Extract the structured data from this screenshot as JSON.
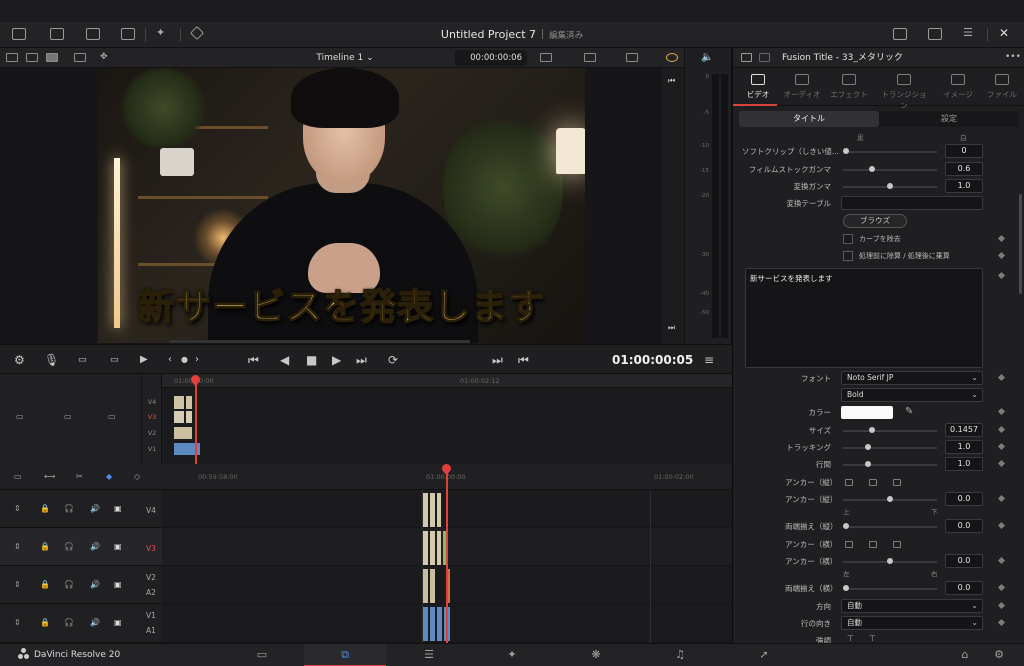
{
  "project": {
    "title": "Untitled Project 7",
    "status": "編集済み"
  },
  "viewer": {
    "timeline_name": "Timeline 1",
    "source_timecode": "00:00:00:06",
    "caption": "新サービスを発表します",
    "playback_timecode": "01:00:00:05"
  },
  "meter": {
    "scale": [
      "0",
      "-5",
      "-10",
      "-15",
      "-20",
      "-30",
      "-40",
      "-50"
    ]
  },
  "timeline": {
    "upper_ruler": [
      "01:00:00:00",
      "01:00:02:12"
    ],
    "upper_tracks": [
      "V4",
      "V3",
      "V2",
      "V1"
    ],
    "lower_ruler": [
      "00:59:58:00",
      "01:00:00:00",
      "01:00:02:00"
    ],
    "tracks": [
      {
        "name": "V4"
      },
      {
        "name": "V3"
      },
      {
        "name": "V2",
        "sub": "A2"
      },
      {
        "name": "V1",
        "sub": "A1"
      }
    ]
  },
  "inspector": {
    "title": "Fusion Title - 33_メタリック",
    "tabs": [
      "ビデオ",
      "オーディオ",
      "エフェクト",
      "トランジション",
      "イメージ",
      "ファイル"
    ],
    "segments": [
      "タイトル",
      "設定"
    ],
    "top_labels": {
      "black": "黒",
      "white": "白"
    },
    "soft_clip": {
      "label": "ソフトクリップ（しきい値...",
      "value": "0"
    },
    "film_gamma": {
      "label": "フィルムストックガンマ",
      "value": "0.6"
    },
    "conv_gamma": {
      "label": "変換ガンマ",
      "value": "1.0"
    },
    "conv_table": {
      "label": "変換テーブル"
    },
    "browse_label": "ブラウズ",
    "remove_curve": "カーブを除去",
    "pre_post": "処理前に除算 / 処理後に乗算",
    "text_value": "新サービスを発表します",
    "font": {
      "label": "フォント",
      "value": "Noto Serif JP",
      "style": "Bold"
    },
    "color_label": "カラー",
    "size": {
      "label": "サイズ",
      "value": "0.1457"
    },
    "tracking": {
      "label": "トラッキング",
      "value": "1.0"
    },
    "line_spacing": {
      "label": "行間",
      "value": "1.0"
    },
    "anchor_v": {
      "label": "アンカー（縦）"
    },
    "anchor_v2": {
      "label": "アンカー（縦）",
      "value": "0.0",
      "min_label": "上",
      "max_label": "下"
    },
    "justify_v": {
      "label": "両端揃え（縦）",
      "value": "0.0"
    },
    "anchor_h": {
      "label": "アンカー（横）"
    },
    "anchor_h2": {
      "label": "アンカー（横）",
      "value": "0.0",
      "min_label": "左",
      "max_label": "右"
    },
    "justify_h": {
      "label": "両端揃え（横）",
      "value": "0.0"
    },
    "direction": {
      "label": "方向",
      "value": "自動"
    },
    "line_direction": {
      "label": "行の向き",
      "value": "自動"
    },
    "emphasis": {
      "label": "強調"
    }
  },
  "bottombar": {
    "brand": "DaVinci Resolve 20"
  }
}
